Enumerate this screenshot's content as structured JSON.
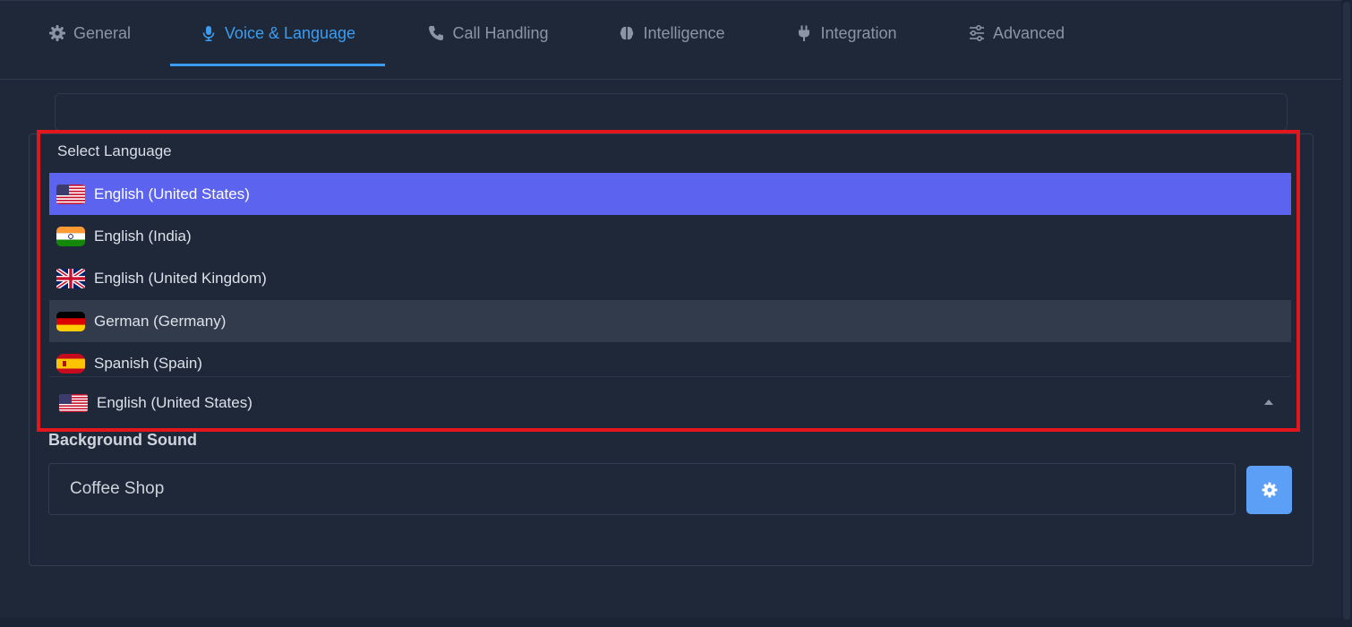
{
  "tabs": [
    {
      "label": "General",
      "icon": "gear-icon"
    },
    {
      "label": "Voice & Language",
      "icon": "microphone-icon"
    },
    {
      "label": "Call Handling",
      "icon": "phone-icon"
    },
    {
      "label": "Intelligence",
      "icon": "brain-icon"
    },
    {
      "label": "Integration",
      "icon": "plug-icon"
    },
    {
      "label": "Advanced",
      "icon": "sliders-icon"
    }
  ],
  "active_tab": "Voice & Language",
  "language_dropdown": {
    "header": "Select Language",
    "options": [
      {
        "label": "English (United States)",
        "flag": "us-flag-icon",
        "state": "selected"
      },
      {
        "label": "English (India)",
        "flag": "india-flag-icon",
        "state": ""
      },
      {
        "label": "English (United Kingdom)",
        "flag": "uk-flag-icon",
        "state": ""
      },
      {
        "label": "German (Germany)",
        "flag": "germany-flag-icon",
        "state": "hovered"
      },
      {
        "label": "Spanish (Spain)",
        "flag": "spain-flag-icon",
        "state": ""
      }
    ],
    "selected_value": "English (United States)"
  },
  "background_sound": {
    "label": "Background Sound",
    "value": "Coffee Shop",
    "settings_icon": "gear-icon"
  },
  "colors": {
    "background": "#1e2839",
    "accent": "#3b9cf3",
    "selected_option": "#5b63ef",
    "highlight_box": "#e3161e",
    "settings_button": "#5c9ff7"
  }
}
